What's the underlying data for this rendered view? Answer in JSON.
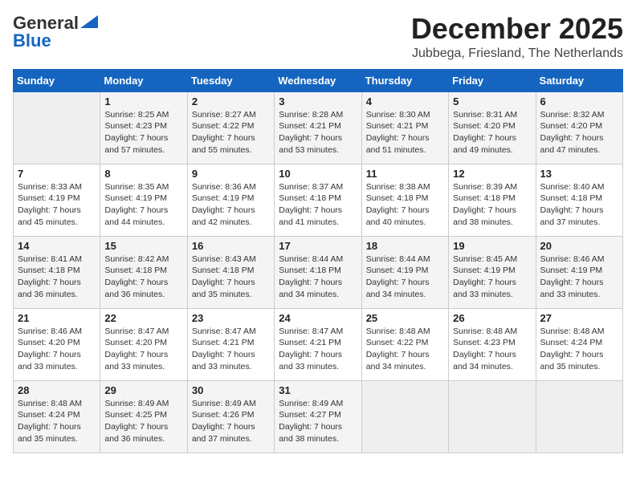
{
  "header": {
    "logo_general": "General",
    "logo_blue": "Blue",
    "month_title": "December 2025",
    "location": "Jubbega, Friesland, The Netherlands"
  },
  "days_of_week": [
    "Sunday",
    "Monday",
    "Tuesday",
    "Wednesday",
    "Thursday",
    "Friday",
    "Saturday"
  ],
  "weeks": [
    [
      {
        "day": "",
        "info": ""
      },
      {
        "day": "1",
        "info": "Sunrise: 8:25 AM\nSunset: 4:23 PM\nDaylight: 7 hours\nand 57 minutes."
      },
      {
        "day": "2",
        "info": "Sunrise: 8:27 AM\nSunset: 4:22 PM\nDaylight: 7 hours\nand 55 minutes."
      },
      {
        "day": "3",
        "info": "Sunrise: 8:28 AM\nSunset: 4:21 PM\nDaylight: 7 hours\nand 53 minutes."
      },
      {
        "day": "4",
        "info": "Sunrise: 8:30 AM\nSunset: 4:21 PM\nDaylight: 7 hours\nand 51 minutes."
      },
      {
        "day": "5",
        "info": "Sunrise: 8:31 AM\nSunset: 4:20 PM\nDaylight: 7 hours\nand 49 minutes."
      },
      {
        "day": "6",
        "info": "Sunrise: 8:32 AM\nSunset: 4:20 PM\nDaylight: 7 hours\nand 47 minutes."
      }
    ],
    [
      {
        "day": "7",
        "info": "Sunrise: 8:33 AM\nSunset: 4:19 PM\nDaylight: 7 hours\nand 45 minutes."
      },
      {
        "day": "8",
        "info": "Sunrise: 8:35 AM\nSunset: 4:19 PM\nDaylight: 7 hours\nand 44 minutes."
      },
      {
        "day": "9",
        "info": "Sunrise: 8:36 AM\nSunset: 4:19 PM\nDaylight: 7 hours\nand 42 minutes."
      },
      {
        "day": "10",
        "info": "Sunrise: 8:37 AM\nSunset: 4:18 PM\nDaylight: 7 hours\nand 41 minutes."
      },
      {
        "day": "11",
        "info": "Sunrise: 8:38 AM\nSunset: 4:18 PM\nDaylight: 7 hours\nand 40 minutes."
      },
      {
        "day": "12",
        "info": "Sunrise: 8:39 AM\nSunset: 4:18 PM\nDaylight: 7 hours\nand 38 minutes."
      },
      {
        "day": "13",
        "info": "Sunrise: 8:40 AM\nSunset: 4:18 PM\nDaylight: 7 hours\nand 37 minutes."
      }
    ],
    [
      {
        "day": "14",
        "info": "Sunrise: 8:41 AM\nSunset: 4:18 PM\nDaylight: 7 hours\nand 36 minutes."
      },
      {
        "day": "15",
        "info": "Sunrise: 8:42 AM\nSunset: 4:18 PM\nDaylight: 7 hours\nand 36 minutes."
      },
      {
        "day": "16",
        "info": "Sunrise: 8:43 AM\nSunset: 4:18 PM\nDaylight: 7 hours\nand 35 minutes."
      },
      {
        "day": "17",
        "info": "Sunrise: 8:44 AM\nSunset: 4:18 PM\nDaylight: 7 hours\nand 34 minutes."
      },
      {
        "day": "18",
        "info": "Sunrise: 8:44 AM\nSunset: 4:19 PM\nDaylight: 7 hours\nand 34 minutes."
      },
      {
        "day": "19",
        "info": "Sunrise: 8:45 AM\nSunset: 4:19 PM\nDaylight: 7 hours\nand 33 minutes."
      },
      {
        "day": "20",
        "info": "Sunrise: 8:46 AM\nSunset: 4:19 PM\nDaylight: 7 hours\nand 33 minutes."
      }
    ],
    [
      {
        "day": "21",
        "info": "Sunrise: 8:46 AM\nSunset: 4:20 PM\nDaylight: 7 hours\nand 33 minutes."
      },
      {
        "day": "22",
        "info": "Sunrise: 8:47 AM\nSunset: 4:20 PM\nDaylight: 7 hours\nand 33 minutes."
      },
      {
        "day": "23",
        "info": "Sunrise: 8:47 AM\nSunset: 4:21 PM\nDaylight: 7 hours\nand 33 minutes."
      },
      {
        "day": "24",
        "info": "Sunrise: 8:47 AM\nSunset: 4:21 PM\nDaylight: 7 hours\nand 33 minutes."
      },
      {
        "day": "25",
        "info": "Sunrise: 8:48 AM\nSunset: 4:22 PM\nDaylight: 7 hours\nand 34 minutes."
      },
      {
        "day": "26",
        "info": "Sunrise: 8:48 AM\nSunset: 4:23 PM\nDaylight: 7 hours\nand 34 minutes."
      },
      {
        "day": "27",
        "info": "Sunrise: 8:48 AM\nSunset: 4:24 PM\nDaylight: 7 hours\nand 35 minutes."
      }
    ],
    [
      {
        "day": "28",
        "info": "Sunrise: 8:48 AM\nSunset: 4:24 PM\nDaylight: 7 hours\nand 35 minutes."
      },
      {
        "day": "29",
        "info": "Sunrise: 8:49 AM\nSunset: 4:25 PM\nDaylight: 7 hours\nand 36 minutes."
      },
      {
        "day": "30",
        "info": "Sunrise: 8:49 AM\nSunset: 4:26 PM\nDaylight: 7 hours\nand 37 minutes."
      },
      {
        "day": "31",
        "info": "Sunrise: 8:49 AM\nSunset: 4:27 PM\nDaylight: 7 hours\nand 38 minutes."
      },
      {
        "day": "",
        "info": ""
      },
      {
        "day": "",
        "info": ""
      },
      {
        "day": "",
        "info": ""
      }
    ]
  ]
}
